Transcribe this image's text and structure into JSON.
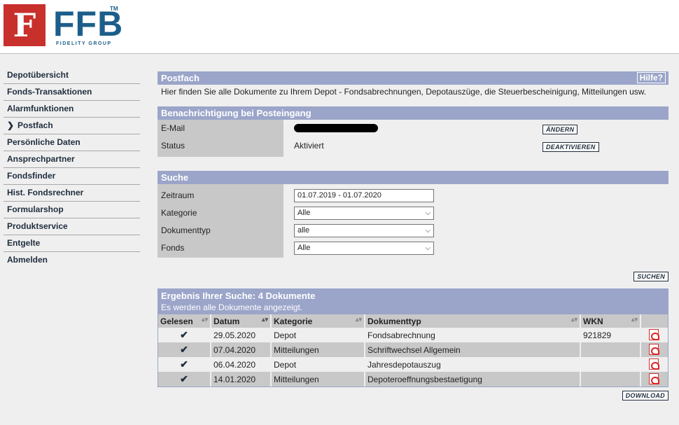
{
  "header": {
    "logo_mark": "F",
    "logo_text": "FFB",
    "logo_tm": "TM",
    "logo_sub": "FIDELITY GROUP"
  },
  "sidebar": {
    "items": [
      {
        "label": "Depotübersicht"
      },
      {
        "label": "Fonds-Transaktionen"
      },
      {
        "label": "Alarmfunktionen"
      },
      {
        "label": "Postfach",
        "active": true
      },
      {
        "label": "Persönliche Daten"
      },
      {
        "label": "Ansprechpartner"
      },
      {
        "label": "Fondsfinder"
      },
      {
        "label": "Hist. Fondsrechner"
      },
      {
        "label": "Formularshop"
      },
      {
        "label": "Produktservice"
      },
      {
        "label": "Entgelte"
      },
      {
        "label": "Abmelden"
      }
    ]
  },
  "postfach": {
    "title": "Postfach",
    "help_label": "Hilfe?",
    "intro": "Hier finden Sie alle Dokumente zu Ihrem Depot - Fondsabrechnungen, Depotauszüge, die Steuerbescheinigung, Mitteilungen usw."
  },
  "notification": {
    "title": "Benachrichtigung bei Posteingang",
    "email_label": "E-Mail",
    "status_label": "Status",
    "status_value": "Aktiviert",
    "change_button": "ÄNDERN",
    "deactivate_button": "DEAKTIVIEREN"
  },
  "search": {
    "title": "Suche",
    "period_label": "Zeitraum",
    "period_value": "01.07.2019 - 01.07.2020",
    "category_label": "Kategorie",
    "category_value": "Alle",
    "doctype_label": "Dokumenttyp",
    "doctype_value": "alle",
    "fund_label": "Fonds",
    "fund_value": "Alle",
    "search_button": "SUCHEN"
  },
  "results": {
    "title": "Ergebnis Ihrer Suche: 4 Dokumente",
    "subtitle": "Es werden alle Dokumente angezeigt.",
    "columns": [
      "Gelesen",
      "Datum",
      "Kategorie",
      "Dokumenttyp",
      "WKN"
    ],
    "rows": [
      {
        "read": "✔",
        "date": "29.05.2020",
        "category": "Depot",
        "doctype": "Fondsabrechnung",
        "wkn": "921829"
      },
      {
        "read": "✔",
        "date": "07.04.2020",
        "category": "Mitteilungen",
        "doctype": "Schriftwechsel Allgemein",
        "wkn": ""
      },
      {
        "read": "✔",
        "date": "06.04.2020",
        "category": "Depot",
        "doctype": "Jahresdepotauszug",
        "wkn": ""
      },
      {
        "read": "✔",
        "date": "14.01.2020",
        "category": "Mitteilungen",
        "doctype": "Depoteroeffnungsbestaetigung",
        "wkn": ""
      }
    ],
    "download_button": "DOWNLOAD"
  },
  "colors": {
    "section_header": "#9ba5c9",
    "logo_red": "#c8302c",
    "logo_blue": "#1c5e8a",
    "label_bg": "#c8c8c8"
  }
}
